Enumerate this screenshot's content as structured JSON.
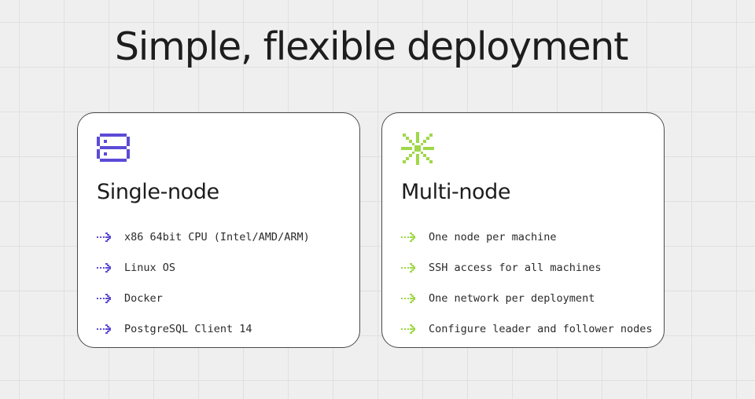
{
  "page": {
    "title": "Simple, flexible deployment"
  },
  "colors": {
    "single_accent": "#5b4bd6",
    "multi_accent": "#9fd848",
    "card_border": "#4a4a4a",
    "background": "#efefef"
  },
  "cards": [
    {
      "title": "Single-node",
      "icon": "server-icon",
      "items": [
        "x86 64bit CPU (Intel/AMD/ARM)",
        "Linux OS",
        "Docker",
        "PostgreSQL Client 14"
      ]
    },
    {
      "title": "Multi-node",
      "icon": "asterisk-network-icon",
      "items": [
        "One node per machine",
        "SSH access for all machines",
        "One network per deployment",
        "Configure leader and follower nodes"
      ]
    }
  ]
}
